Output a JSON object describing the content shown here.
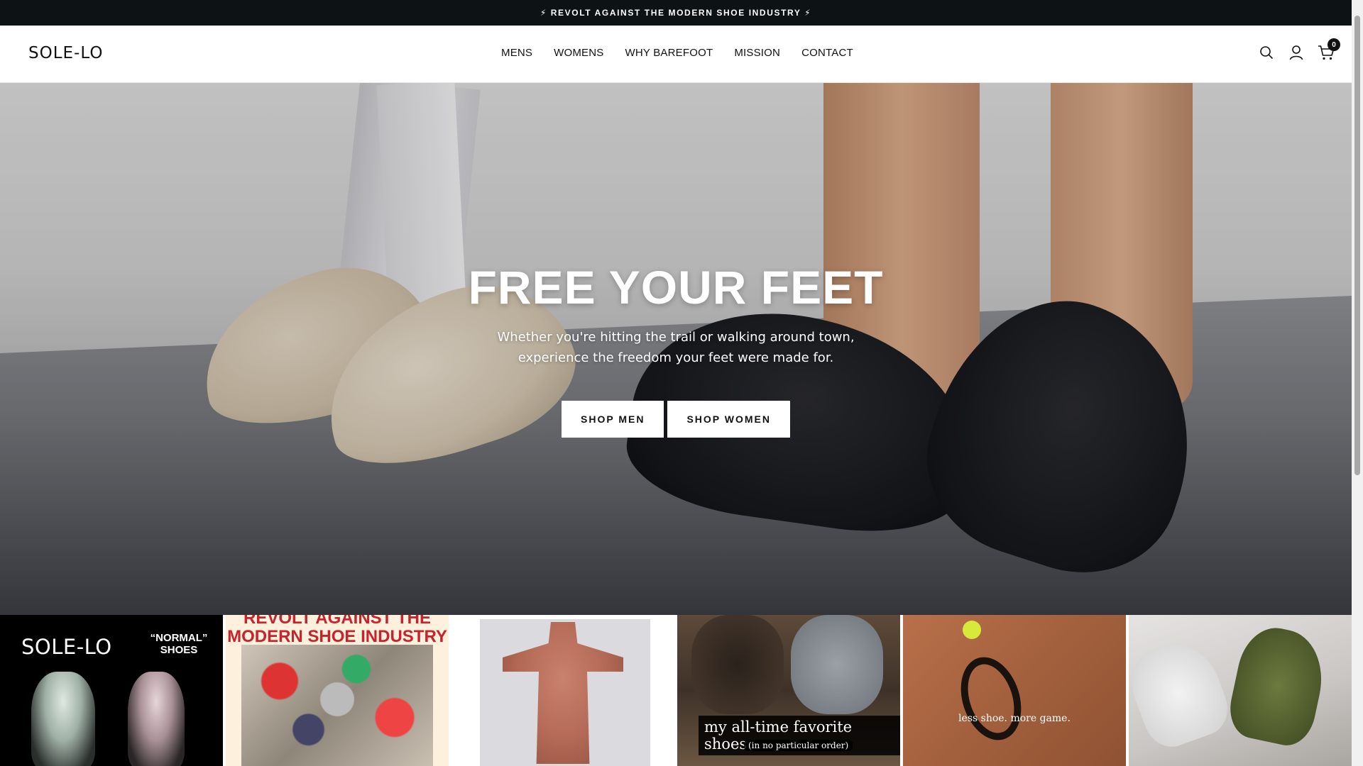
{
  "announcement": {
    "text": "⚡ REVOLT AGAINST THE MODERN SHOE INDUSTRY ⚡"
  },
  "header": {
    "logo": "SOLE-LO",
    "nav": [
      "MENS",
      "WOMENS",
      "WHY BAREFOOT",
      "MISSION",
      "CONTACT"
    ],
    "icons": [
      "search-icon",
      "account-icon",
      "cart-icon"
    ],
    "cart_count": "0"
  },
  "hero": {
    "title": "FREE YOUR FEET",
    "subtitle": "Whether you're hitting the trail or walking around town, experience the freedom your feet were made for.",
    "buttons": [
      "SHOP MEN",
      "SHOP WOMEN"
    ]
  },
  "tiles": {
    "t1": {
      "brand": "SOLE-LO",
      "compare": "“NORMAL” SHOES"
    },
    "t2": {
      "headline": "REVOLT AGAINST THE MODERN SHOE INDUSTRY"
    },
    "t4": {
      "caption": "my all-time favorite shoes",
      "subcaption": "(in no particular order)"
    },
    "t5": {
      "caption": "less shoe. more game."
    }
  },
  "colors": {
    "announcement_bg": "#0d1214",
    "hero_text": "#ffffff",
    "accent_red": "#c6232b"
  }
}
